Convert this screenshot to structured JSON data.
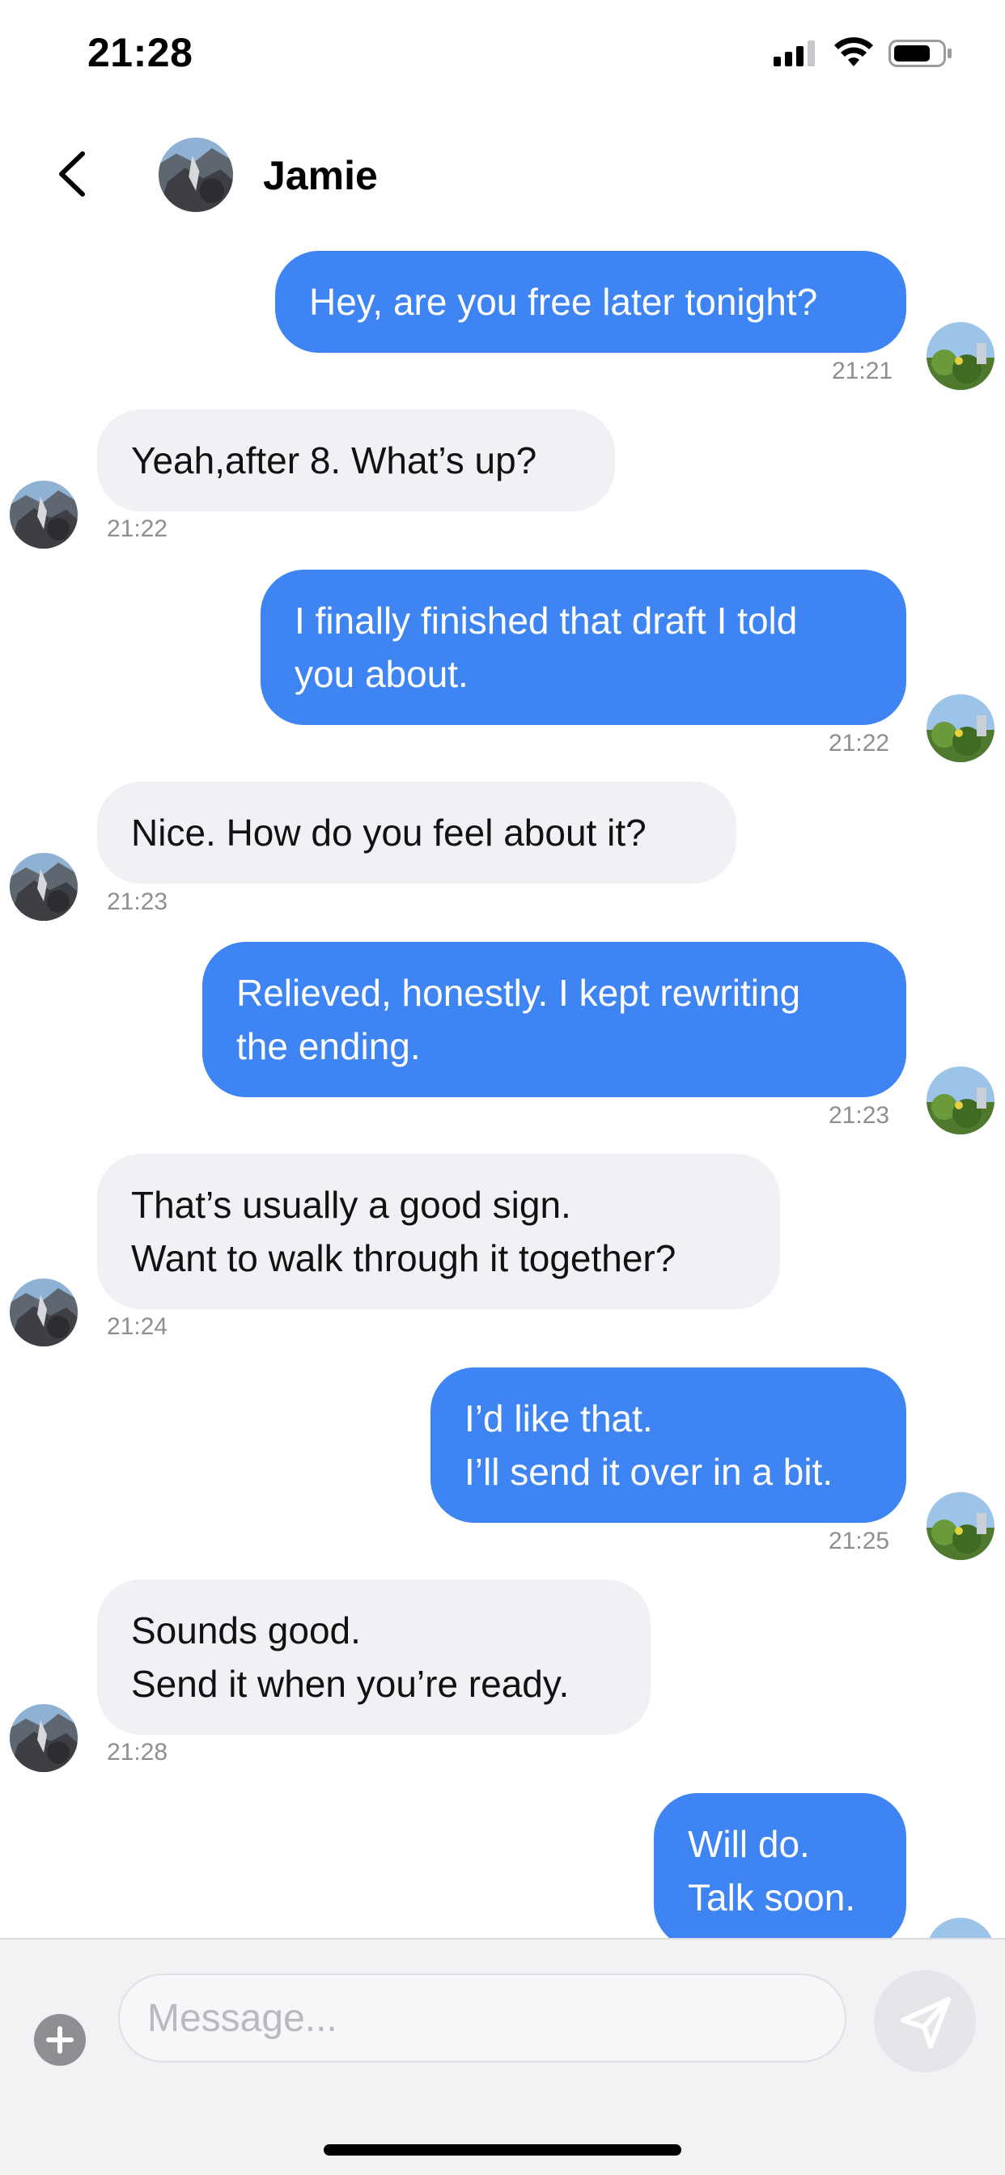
{
  "status_bar": {
    "time": "21:28"
  },
  "header": {
    "contact_name": "Jamie",
    "back_icon": "chevron-left-icon"
  },
  "messages": [
    {
      "direction": "out",
      "text": "Hey, are you free later tonight?",
      "time": "21:21"
    },
    {
      "direction": "in",
      "text": "Yeah,after 8. What’s up?",
      "time": "21:22"
    },
    {
      "direction": "out",
      "text": "I finally finished that draft I told\nyou about.",
      "time": "21:22"
    },
    {
      "direction": "in",
      "text": "Nice. How do you feel about it?",
      "time": "21:23"
    },
    {
      "direction": "out",
      "text": "Relieved, honestly. I kept rewriting\nthe ending.",
      "time": "21:23"
    },
    {
      "direction": "in",
      "text": "That’s usually a good sign.\nWant to walk through it together?",
      "time": "21:24"
    },
    {
      "direction": "out",
      "text": "I’d like that.\nI’ll send it over in a bit.",
      "time": "21:25"
    },
    {
      "direction": "in",
      "text": "Sounds good.\nSend it when you’re ready.",
      "time": "21:28"
    },
    {
      "direction": "out",
      "text": "Will do.\nTalk soon.",
      "time": ""
    }
  ],
  "input": {
    "placeholder": "Message...",
    "value": ""
  },
  "colors": {
    "outgoing_bubble": "#3e84f3",
    "incoming_bubble": "#f1f1f5",
    "timestamp": "#8e8e93"
  },
  "icons": {
    "add": "plus-icon",
    "send": "paper-plane-icon"
  }
}
